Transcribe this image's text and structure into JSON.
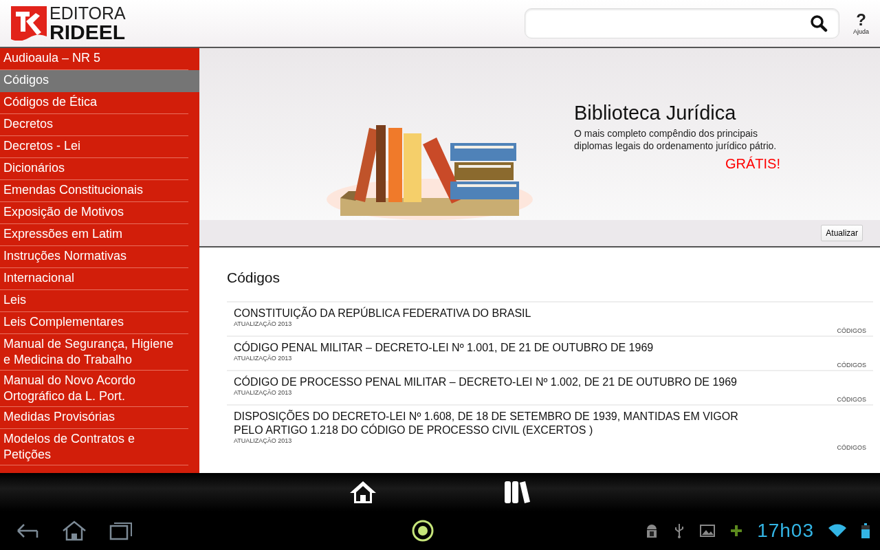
{
  "header": {
    "logo": {
      "line1": "EDITORA",
      "line2": "RIDEEL"
    },
    "help": {
      "symbol": "?",
      "label": "Ajuda"
    }
  },
  "sidebar": {
    "items": [
      {
        "label": "Audioaula – NR 5",
        "selected": false
      },
      {
        "label": "Códigos",
        "selected": true
      },
      {
        "label": "Códigos de Ética",
        "selected": false
      },
      {
        "label": "Decretos",
        "selected": false
      },
      {
        "label": "Decretos - Lei",
        "selected": false
      },
      {
        "label": "Dicionários",
        "selected": false
      },
      {
        "label": "Emendas Constitucionais",
        "selected": false
      },
      {
        "label": "Exposição de Motivos",
        "selected": false
      },
      {
        "label": "Expressões em Latim",
        "selected": false
      },
      {
        "label": "Instruções Normativas",
        "selected": false
      },
      {
        "label": "Internacional",
        "selected": false
      },
      {
        "label": "Leis",
        "selected": false
      },
      {
        "label": "Leis Complementares",
        "selected": false
      },
      {
        "label": "Manual de Segurança, Higiene e Medicina do Trabalho",
        "selected": false
      },
      {
        "label": "Manual do Novo Acordo Ortográfico da L. Port.",
        "selected": false
      },
      {
        "label": "Medidas Provisórias",
        "selected": false
      },
      {
        "label": "Modelos de Contratos e Petições",
        "selected": false
      }
    ]
  },
  "banner": {
    "title": "Biblioteca Jurídica",
    "description": "O mais completo compêndio dos principais diplomas legais do ordenamento jurídico pátrio.",
    "price": "GRÁTIS!",
    "refresh_button": "Atualizar"
  },
  "section_title": "Códigos",
  "documents": [
    {
      "title": "CONSTITUIÇÃO DA REPÚBLICA FEDERATIVA DO BRASIL",
      "updated": "ATUALIZAÇÃO 2013",
      "category": "CÓDIGOS"
    },
    {
      "title": "CÓDIGO PENAL MILITAR – DECRETO-LEI  Nº 1.001, DE 21 DE OUTUBRO DE 1969",
      "updated": "ATUALIZAÇÃO 2013",
      "category": "CÓDIGOS"
    },
    {
      "title": "CÓDIGO DE PROCESSO PENAL MILITAR – DECRETO-LEI  Nº 1.002, DE 21 DE OUTUBRO DE 1969",
      "updated": "ATUALIZAÇÃO 2013",
      "category": "CÓDIGOS"
    },
    {
      "title": "DISPOSIÇÕES DO DECRETO-LEI  Nº 1.608, DE 18 DE SETEMBRO DE 1939, MANTIDAS EM VIGOR PELO ARTIGO 1.218 DO CÓDIGO DE PROCESSO CIVIL (EXCERTOS )",
      "updated": "ATUALIZAÇÃO 2013",
      "category": "CÓDIGOS"
    }
  ],
  "status_bar": {
    "time": "17h03"
  }
}
